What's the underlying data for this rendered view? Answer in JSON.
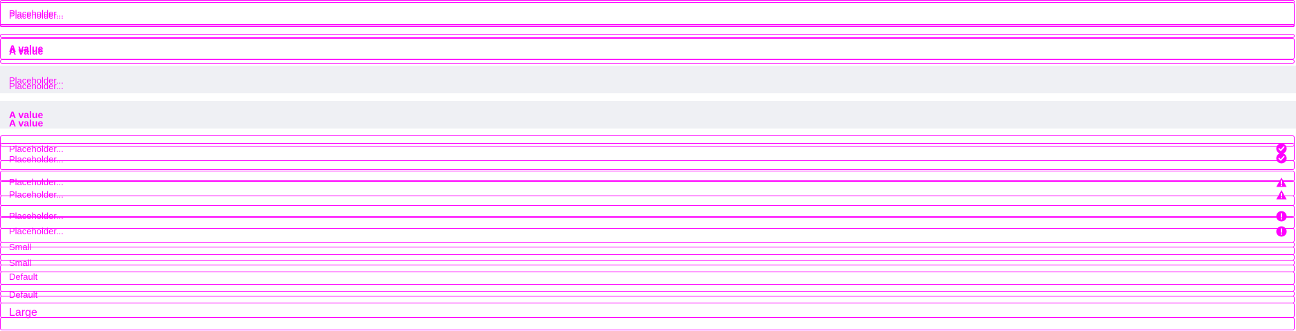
{
  "inputs": {
    "placeholder": "Placeholder...",
    "value": "A value"
  },
  "sizes": {
    "small": "Small",
    "default": "Default",
    "large": "Large"
  },
  "icons": {
    "success": "check-circle-icon",
    "warning": "warning-triangle-icon",
    "error": "exclamation-circle-icon"
  },
  "colors": {
    "outline": "#ff00ff",
    "filled_background": "#eff0f4",
    "page_background": "#ffffff"
  }
}
